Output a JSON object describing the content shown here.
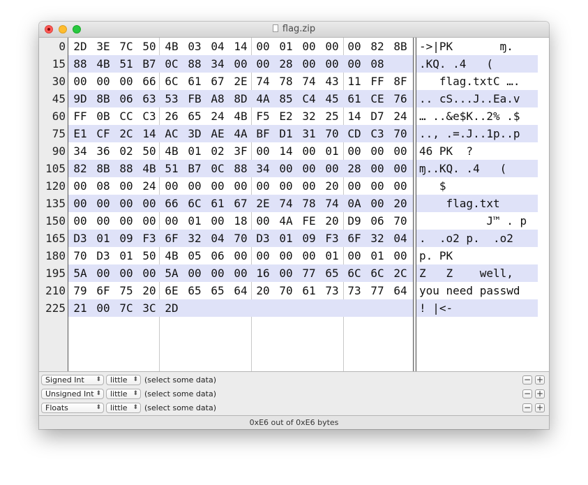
{
  "window": {
    "title": "flag.zip"
  },
  "rows": [
    {
      "offset": "0",
      "bytes": [
        "2D",
        "3E",
        "7C",
        "50",
        "4B",
        "03",
        "04",
        "14",
        "00",
        "01",
        "00",
        "00",
        "00",
        "82",
        "8B"
      ],
      "ascii": "->|PK       ɱ."
    },
    {
      "offset": "15",
      "bytes": [
        "88",
        "4B",
        "51",
        "B7",
        "0C",
        "88",
        "34",
        "00",
        "00",
        "28",
        "00",
        "00",
        "00",
        "08"
      ],
      "ascii": ".KQ. .4   ("
    },
    {
      "offset": "30",
      "bytes": [
        "00",
        "00",
        "00",
        "66",
        "6C",
        "61",
        "67",
        "2E",
        "74",
        "78",
        "74",
        "43",
        "11",
        "FF",
        "8F"
      ],
      "ascii": "   flag.txtC …."
    },
    {
      "offset": "45",
      "bytes": [
        "9D",
        "8B",
        "06",
        "63",
        "53",
        "FB",
        "A8",
        "8D",
        "4A",
        "85",
        "C4",
        "45",
        "61",
        "CE",
        "76"
      ],
      "ascii": ".. cS...J..Ea.v"
    },
    {
      "offset": "60",
      "bytes": [
        "FF",
        "0B",
        "CC",
        "C3",
        "26",
        "65",
        "24",
        "4B",
        "F5",
        "E2",
        "32",
        "25",
        "14",
        "D7",
        "24"
      ],
      "ascii": "… ..&e$K..2% .$"
    },
    {
      "offset": "75",
      "bytes": [
        "E1",
        "CF",
        "2C",
        "14",
        "AC",
        "3D",
        "AE",
        "4A",
        "BF",
        "D1",
        "31",
        "70",
        "CD",
        "C3",
        "70"
      ],
      "ascii": ".., .=.J..1p..p"
    },
    {
      "offset": "90",
      "bytes": [
        "34",
        "36",
        "02",
        "50",
        "4B",
        "01",
        "02",
        "3F",
        "00",
        "14",
        "00",
        "01",
        "00",
        "00",
        "00"
      ],
      "ascii": "46 PK  ?"
    },
    {
      "offset": "105",
      "bytes": [
        "82",
        "8B",
        "88",
        "4B",
        "51",
        "B7",
        "0C",
        "88",
        "34",
        "00",
        "00",
        "00",
        "28",
        "00",
        "00"
      ],
      "ascii": "ɱ..KQ. .4   ("
    },
    {
      "offset": "120",
      "bytes": [
        "00",
        "08",
        "00",
        "24",
        "00",
        "00",
        "00",
        "00",
        "00",
        "00",
        "00",
        "20",
        "00",
        "00",
        "00"
      ],
      "ascii": "   $"
    },
    {
      "offset": "135",
      "bytes": [
        "00",
        "00",
        "00",
        "00",
        "66",
        "6C",
        "61",
        "67",
        "2E",
        "74",
        "78",
        "74",
        "0A",
        "00",
        "20"
      ],
      "ascii": "    flag.txt"
    },
    {
      "offset": "150",
      "bytes": [
        "00",
        "00",
        "00",
        "00",
        "00",
        "01",
        "00",
        "18",
        "00",
        "4A",
        "FE",
        "20",
        "D9",
        "06",
        "70"
      ],
      "ascii": "          J™ . p"
    },
    {
      "offset": "165",
      "bytes": [
        "D3",
        "01",
        "09",
        "F3",
        "6F",
        "32",
        "04",
        "70",
        "D3",
        "01",
        "09",
        "F3",
        "6F",
        "32",
        "04"
      ],
      "ascii": ".  .o2 p.  .o2"
    },
    {
      "offset": "180",
      "bytes": [
        "70",
        "D3",
        "01",
        "50",
        "4B",
        "05",
        "06",
        "00",
        "00",
        "00",
        "00",
        "01",
        "00",
        "01",
        "00"
      ],
      "ascii": "p. PK"
    },
    {
      "offset": "195",
      "bytes": [
        "5A",
        "00",
        "00",
        "00",
        "5A",
        "00",
        "00",
        "00",
        "16",
        "00",
        "77",
        "65",
        "6C",
        "6C",
        "2C"
      ],
      "ascii": "Z   Z    well,"
    },
    {
      "offset": "210",
      "bytes": [
        "79",
        "6F",
        "75",
        "20",
        "6E",
        "65",
        "65",
        "64",
        "20",
        "70",
        "61",
        "73",
        "73",
        "77",
        "64"
      ],
      "ascii": "you need passwd"
    },
    {
      "offset": "225",
      "bytes": [
        "21",
        "00",
        "7C",
        "3C",
        "2D"
      ],
      "ascii": "! |<-"
    }
  ],
  "inspector": [
    {
      "type": "Signed Int",
      "endian": "little",
      "value": "(select some data)"
    },
    {
      "type": "Unsigned Int",
      "endian": "little",
      "value": "(select some data)"
    },
    {
      "type": "Floats",
      "endian": "little",
      "value": "(select some data)"
    }
  ],
  "inspector_buttons": {
    "minus": "−",
    "plus": "+"
  },
  "status": "0xE6 out of 0xE6 bytes"
}
